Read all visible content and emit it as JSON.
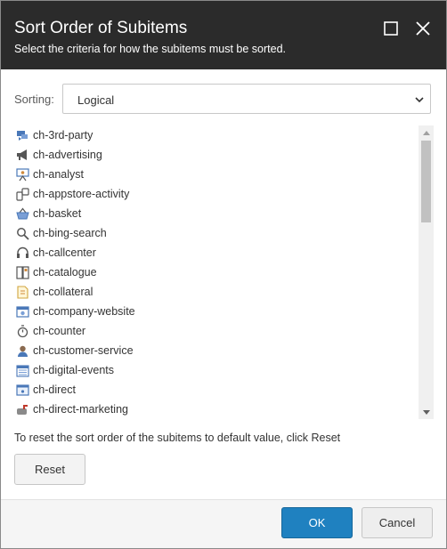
{
  "dialog": {
    "title": "Sort Order of Subitems",
    "subtitle": "Select the criteria for how the subitems must be sorted."
  },
  "sorting": {
    "label": "Sorting:",
    "value": "Logical"
  },
  "items": [
    {
      "label": "ch-3rd-party",
      "icon": "party-network-icon"
    },
    {
      "label": "ch-advertising",
      "icon": "megaphone-icon"
    },
    {
      "label": "ch-analyst",
      "icon": "presenter-board-icon"
    },
    {
      "label": "ch-appstore-activity",
      "icon": "mobile-devices-icon"
    },
    {
      "label": "ch-basket",
      "icon": "basket-icon"
    },
    {
      "label": "ch-bing-search",
      "icon": "magnifier-icon"
    },
    {
      "label": "ch-callcenter",
      "icon": "headset-icon"
    },
    {
      "label": "ch-catalogue",
      "icon": "catalogue-icon"
    },
    {
      "label": "ch-collateral",
      "icon": "document-icon"
    },
    {
      "label": "ch-company-website",
      "icon": "web-page-icon"
    },
    {
      "label": "ch-counter",
      "icon": "stopwatch-icon"
    },
    {
      "label": "ch-customer-service",
      "icon": "service-agent-icon"
    },
    {
      "label": "ch-digital-events",
      "icon": "calendar-icon"
    },
    {
      "label": "ch-direct",
      "icon": "browser-window-icon"
    },
    {
      "label": "ch-direct-marketing",
      "icon": "mailbox-icon"
    }
  ],
  "reset": {
    "hint": "To reset the sort order of the subitems to default value, click Reset",
    "button": "Reset"
  },
  "footer": {
    "ok": "OK",
    "cancel": "Cancel"
  },
  "colors": {
    "header_bg": "#2b2b2b",
    "primary_button": "#1f81c0",
    "icon_blue": "#4a78b8"
  }
}
